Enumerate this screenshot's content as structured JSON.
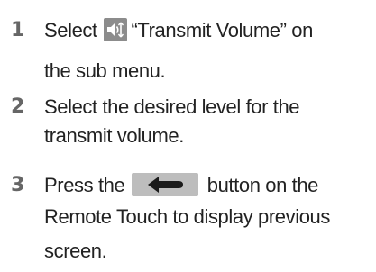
{
  "steps": [
    {
      "number": "1",
      "before_icon": "Select ",
      "icon": "transmit-volume-icon",
      "after_icon": "“Transmit Volume” on",
      "line2": "the sub menu."
    },
    {
      "number": "2",
      "line1": "Select the desired level for the",
      "line2": "transmit volume."
    },
    {
      "number": "3",
      "before_icon": "Press the ",
      "icon": "back-arrow-icon",
      "after_icon": " button on the",
      "line2": "Remote Touch to display previous",
      "line3": "screen."
    }
  ],
  "colors": {
    "step_number": "#666666",
    "text": "#222222",
    "volume_icon_bg": "#8c8c8c",
    "back_button_bg": "#bdbdbd",
    "back_arrow": "#1a1a1a"
  }
}
